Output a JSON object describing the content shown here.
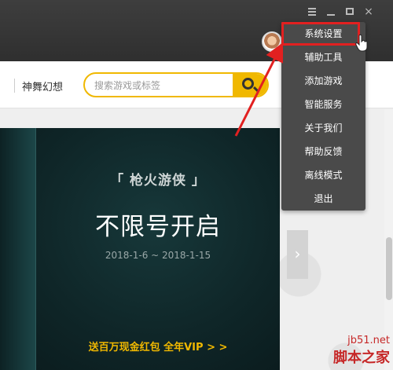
{
  "titlebar": {
    "controls": [
      "menu-icon",
      "minimize-icon",
      "maximize-icon",
      "close-icon"
    ],
    "close_symbol": "×"
  },
  "navbar": {
    "item": "神舞幻想",
    "search_placeholder": "搜索游戏或标签",
    "search_icon": "search-icon",
    "accent_color": "#f0b800"
  },
  "banner": {
    "game_title": "「 枪火游侠 」",
    "headline": "不限号开启",
    "date_range": "2018-1-6 ~ 2018-1-15",
    "promo": "送百万现金红包 全年VIP > >",
    "next_symbol": "›"
  },
  "dropdown": {
    "items": [
      "系统设置",
      "辅助工具",
      "添加游戏",
      "智能服务",
      "关于我们",
      "帮助反馈",
      "离线模式",
      "退出"
    ],
    "highlighted": "系统设置",
    "highlight_color": "#e22020"
  },
  "watermark": {
    "site": "jb51.net",
    "name": "脚本之家"
  }
}
